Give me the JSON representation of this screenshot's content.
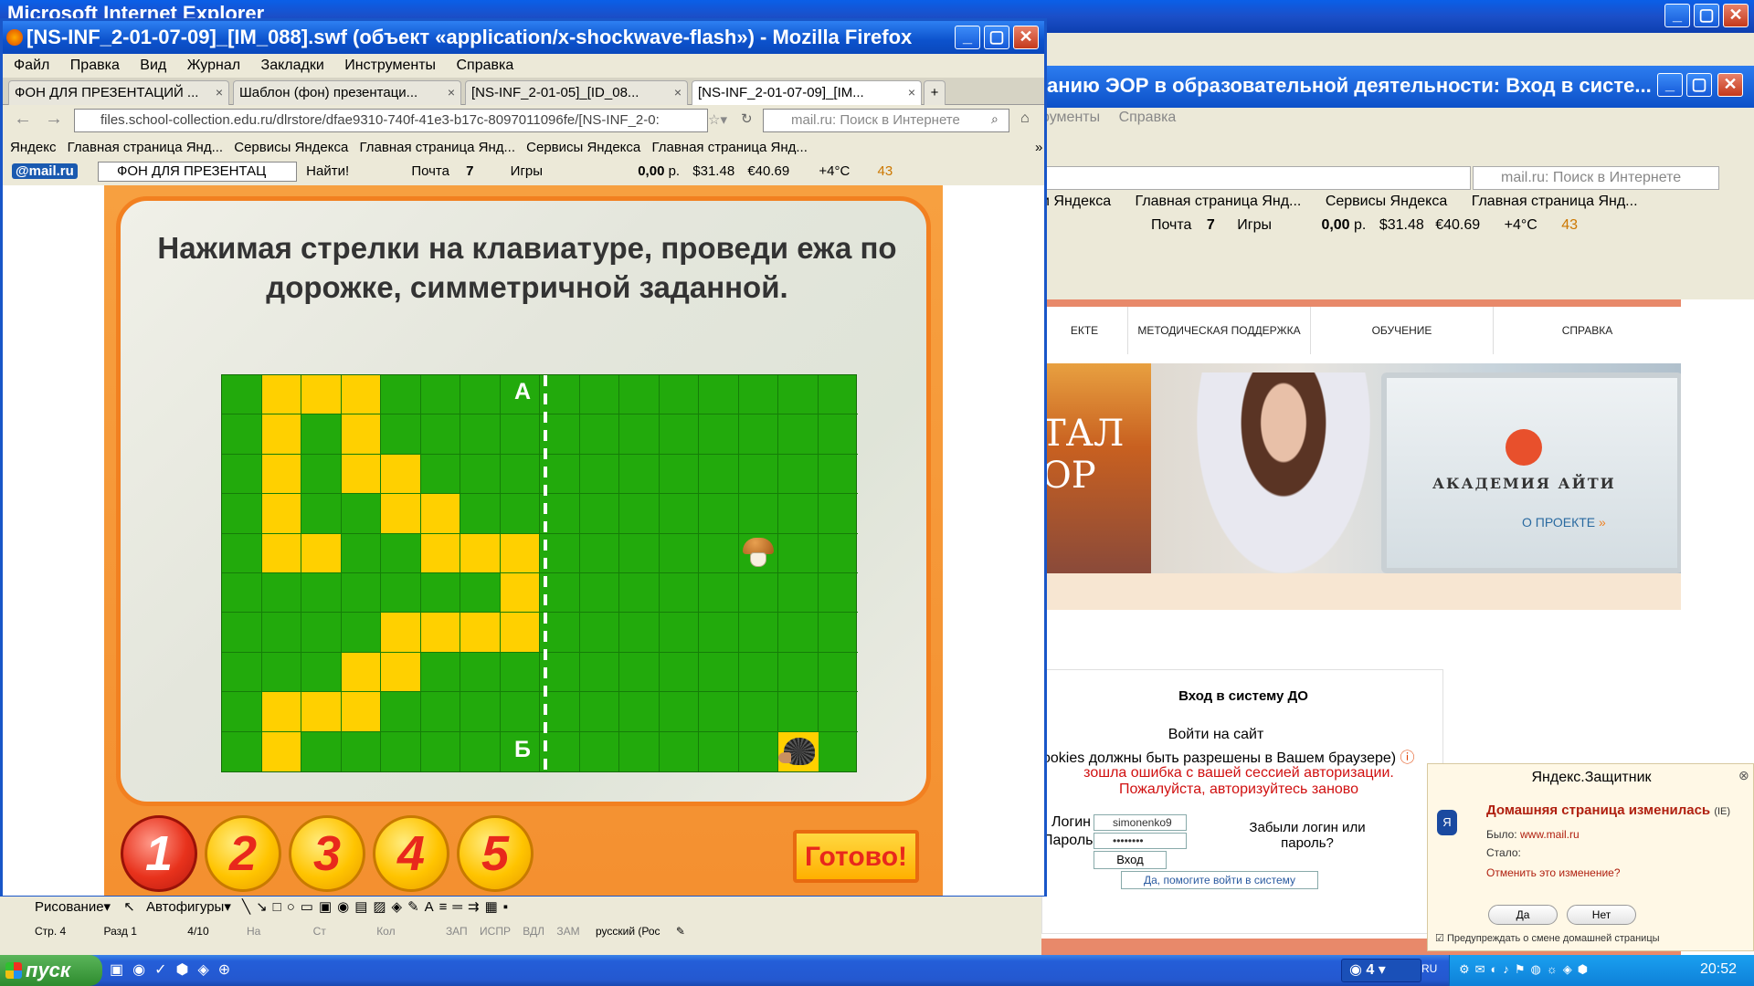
{
  "ie": {
    "title": "Microsoft Internet Explorer"
  },
  "background_window": {
    "title": "анию ЭОР в образовательной деятельности: Вход в систе...",
    "menu": [
      "рументы",
      "Справка"
    ],
    "search_placeholder": "mail.ru: Поиск в Интернете",
    "bookmarks": [
      "и Яндекса",
      "Главная страница Янд...",
      "Сервисы Яндекса",
      "Главная страница Янд..."
    ],
    "mailbar": {
      "mail": "Почта",
      "count": "7",
      "games": "Игры",
      "balance": "0,00",
      "currency": "р.",
      "usd": "$31.48",
      "eur": "€40.69",
      "temp": "+4°C",
      "badge": "43"
    },
    "nav": [
      "ЕКТЕ",
      "МЕТОДИЧЕСКАЯ ПОДДЕРЖКА",
      "ОБУЧЕНИЕ",
      "СПРАВКА"
    ],
    "hero": {
      "text_left": "ТАЛ",
      "text_left2": "ОР",
      "brand": "АКАДЕМИЯ АЙТИ",
      "link": "О ПРОЕКТЕ"
    },
    "login": {
      "title": "Вход в систему ДО",
      "subtitle": "Войти на сайт",
      "cookies": "ookies должны быть разрешены в Вашем браузере)",
      "error": "зошла ошибка с вашей сессией авторизации. Пожалуйста, авторизуйтесь заново",
      "login_label": "Логин",
      "password_label": "Пароль",
      "login_value": "simonenko9",
      "password_value": "••••••••",
      "enter": "Вход",
      "forgot": "Забыли логин или пароль?",
      "help": "Да, помогите войти в систему"
    }
  },
  "defender": {
    "title": "Яндекс.Защитник",
    "heading": "Домашняя страница изменилась",
    "browser": "(IE)",
    "was_label": "Было:",
    "was_value": "www.mail.ru",
    "now_label": "Стало:",
    "question": "Отменить это изменение?",
    "yes": "Да",
    "no": "Нет",
    "checkbox": "Предупреждать о смене домашней страницы"
  },
  "word": {
    "drawing": "Рисование",
    "autoshapes": "Автофигуры",
    "status": [
      "Стр. 4",
      "Разд 1",
      "4/10",
      "На",
      "Ст",
      "Кол",
      "ЗАП",
      "ИСПР",
      "ВДЛ",
      "ЗАМ",
      "русский (Рос"
    ]
  },
  "taskbar": {
    "start": "пуск",
    "group_count": "4",
    "lang": "RU",
    "time": "20:52"
  },
  "firefox": {
    "title": "[NS-INF_2-01-07-09]_[IM_088].swf (объект «application/x-shockwave-flash») - Mozilla Firefox",
    "menu": [
      "Файл",
      "Правка",
      "Вид",
      "Журнал",
      "Закладки",
      "Инструменты",
      "Справка"
    ],
    "tabs": [
      {
        "label": "ФОН ДЛЯ ПРЕЗЕНТАЦИЙ ..."
      },
      {
        "label": "Шаблон (фон) презентаци..."
      },
      {
        "label": "[NS-INF_2-01-05]_[ID_08..."
      },
      {
        "label": "[NS-INF_2-01-07-09]_[IM..."
      }
    ],
    "url": "files.school-collection.edu.ru/dlrstore/dfae9310-740f-41e3-b17c-8097011096fe/[NS-INF_2-0:",
    "search_placeholder": "mail.ru: Поиск в Интернете",
    "bookmarks": [
      "Яндекс",
      "Главная страница Янд...",
      "Сервисы Яндекса",
      "Главная страница Янд...",
      "Сервисы Яндекса",
      "Главная страница Янд..."
    ],
    "mailbar": {
      "logo": "@mail.ru",
      "search_value": "ФОН ДЛЯ ПРЕЗЕНТАЦ",
      "find": "Найти!",
      "mail": "Почта",
      "count": "7",
      "games": "Игры",
      "balance": "0,00",
      "currency": "р.",
      "usd": "$31.48",
      "eur": "€40.69",
      "temp": "+4°C",
      "badge": "43"
    }
  },
  "flash": {
    "task": "Нажимая стрелки на клавиатуре, проведи ежа по дорожке, симметричной заданной.",
    "point_a": "А",
    "point_b": "Б",
    "grid": {
      "cols": 16,
      "rows": 10,
      "path_cells": [
        [
          1,
          0
        ],
        [
          2,
          0
        ],
        [
          3,
          0
        ],
        [
          1,
          1
        ],
        [
          3,
          1
        ],
        [
          1,
          2
        ],
        [
          3,
          2
        ],
        [
          4,
          2
        ],
        [
          1,
          3
        ],
        [
          4,
          3
        ],
        [
          5,
          3
        ],
        [
          1,
          4
        ],
        [
          2,
          4
        ],
        [
          5,
          4
        ],
        [
          6,
          4
        ],
        [
          7,
          4
        ],
        [
          7,
          5
        ],
        [
          4,
          6
        ],
        [
          5,
          6
        ],
        [
          6,
          6
        ],
        [
          7,
          6
        ],
        [
          3,
          7
        ],
        [
          4,
          7
        ],
        [
          1,
          8
        ],
        [
          2,
          8
        ],
        [
          3,
          8
        ],
        [
          1,
          9
        ]
      ],
      "mushroom_cell": [
        13,
        4
      ],
      "hedgehog_cell": [
        14,
        9
      ]
    },
    "buttons": [
      "1",
      "2",
      "3",
      "4",
      "5"
    ],
    "selected": "1",
    "done": "Готово!"
  },
  "colors": {
    "grass": "#22aa0c",
    "path": "#ffd000",
    "frame": "#f28020"
  }
}
